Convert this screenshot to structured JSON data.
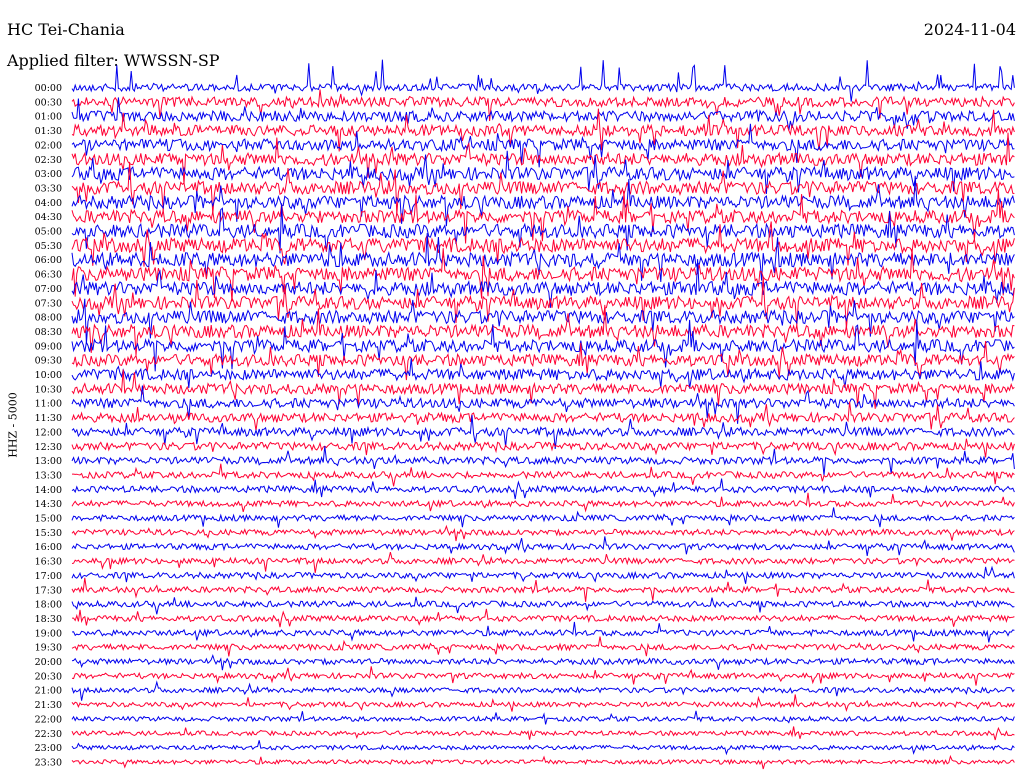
{
  "station": "HC Tei-Chania",
  "date": "2024-11-04",
  "filter_label": "Applied filter: WWSSN-SP",
  "channel_label": "HHZ - 5000",
  "colors": {
    "traceA": "#0000ee",
    "traceB": "#ff0033"
  },
  "chart_data": {
    "type": "line",
    "title": "HC Tei-Chania",
    "subtitle": "2024-11-04",
    "ylabel": "HHZ - 5000",
    "y_tick_labels": [
      "00:00",
      "00:30",
      "01:00",
      "01:30",
      "02:00",
      "02:30",
      "03:00",
      "03:30",
      "04:00",
      "04:30",
      "05:00",
      "05:30",
      "06:00",
      "06:30",
      "07:00",
      "07:30",
      "08:00",
      "08:30",
      "09:00",
      "09:30",
      "10:00",
      "10:30",
      "11:00",
      "11:30",
      "12:00",
      "12:30",
      "13:00",
      "13:30",
      "14:00",
      "14:30",
      "15:00",
      "15:30",
      "16:00",
      "16:30",
      "17:00",
      "17:30",
      "18:00",
      "18:30",
      "19:00",
      "19:30",
      "20:00",
      "20:30",
      "21:00",
      "21:30",
      "22:00",
      "22:30",
      "23:00",
      "23:30"
    ],
    "trace_colors_alternate": [
      "blue",
      "red"
    ],
    "relative_noise_amplitude": [
      0.55,
      0.75,
      0.8,
      0.85,
      0.9,
      0.95,
      1.0,
      1.0,
      1.0,
      1.0,
      1.05,
      1.1,
      1.1,
      1.1,
      1.05,
      1.0,
      1.0,
      1.0,
      0.95,
      0.9,
      0.85,
      0.8,
      0.75,
      0.7,
      0.65,
      0.6,
      0.55,
      0.5,
      0.5,
      0.45,
      0.45,
      0.45,
      0.45,
      0.45,
      0.45,
      0.45,
      0.45,
      0.45,
      0.45,
      0.45,
      0.45,
      0.42,
      0.4,
      0.38,
      0.36,
      0.35,
      0.34,
      0.33
    ]
  }
}
